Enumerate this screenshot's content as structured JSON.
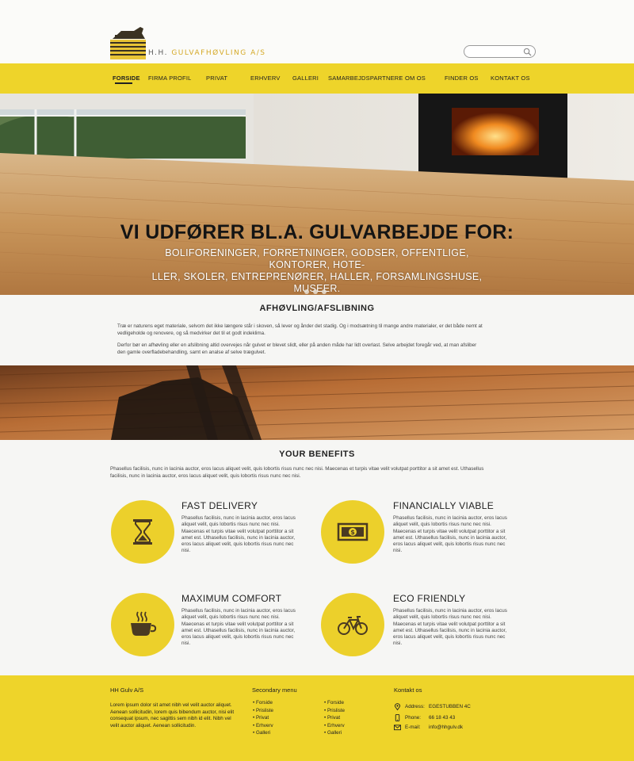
{
  "brand": {
    "name_prefix": "H.H.",
    "name_main": "GULVAFHØVLING A/S",
    "accent_color": "#eed42a"
  },
  "search": {
    "placeholder": ""
  },
  "nav": {
    "items": [
      {
        "label": "FORSIDE",
        "active": true
      },
      {
        "label": "FIRMA PROFIL"
      },
      {
        "label": "PRIVAT"
      },
      {
        "label": "ERHVERV"
      },
      {
        "label": "GALLERI"
      },
      {
        "label": "SAMARBEJDSPARTNERE"
      },
      {
        "label": "OM OS"
      },
      {
        "label": "FINDER OS"
      },
      {
        "label": "KONTAKT OS"
      }
    ]
  },
  "hero": {
    "title": "VI UDFØRER BL.A. GULVARBEJDE FOR:",
    "subtitle_line1": "BOLIFORENINGER, FORRETNINGER, GODSER, OFFENTLIGE, KONTORER, HOTE-",
    "subtitle_line2": "LLER, SKOLER, ENTREPRENØRER, HALLER, FORSAMLINGSHUSE, MUSEER.",
    "slides": 3,
    "active_slide": 1
  },
  "about": {
    "title": "AFHØVLING/AFSLIBNING",
    "para1_line1": "Træ er naturens eget materiale, selvom det ikke længere står i skoven, så lever og ånder det stadig. Og i modsætning til mange andre materialer, er det både nemt at",
    "para1_line2": "vedligeholde og renovere, og så medvirker det til et godt indeklima.",
    "para2_line1": "Derfor bør en afhøvling eller en afslibning altid overvejes når gulvet er blevet slidt, eller på anden måde har lidt overlast. Selve arbejdet foregår ved, at man afsliber",
    "para2_line2": "den gamle overfladebehandling, samt en analse af selve trægulvet."
  },
  "benefits": {
    "title": "YOUR BENEFITS",
    "intro_line1": "Phasellus facilisis, nunc in lacinia auctor, eros lacus aliquet velit, quis lobortis risus nunc nec nisi. Maecenas et turpis vitae velit volutpat porttitor a sit amet est. Uthasellus",
    "intro_line2": "facilisis, nunc in lacinia auctor, eros lacus aliquet velit, quis lobortis risus nunc nec nisi.",
    "items": [
      {
        "title": "FAST DELIVERY",
        "icon": "hourglass-icon",
        "lines": [
          "Phasellus facilisis, nunc in lacinia auctor, eros lacus",
          "aliquet velit, quis lobortis risus nunc nec nisi.",
          "Maecenas et turpis vitae velit volutpat porttitor a sit",
          "amet est. Uthasellus facilisis, nunc in lacinia auctor,",
          "eros lacus aliquet velit, quis lobortis risus nunc nec",
          "nisi."
        ]
      },
      {
        "title": "FINANCIALLY VIABLE",
        "icon": "banknote-icon",
        "lines": [
          "Phasellus facilisis, nunc in lacinia auctor, eros lacus",
          "aliquet velit, quis lobortis risus nunc nec nisi.",
          "Maecenas et turpis vitae velit volutpat porttitor a sit",
          "amet est. Uthasellus facilisis, nunc in lacinia auctor,",
          "eros lacus aliquet velit, quis lobortis risus nunc nec",
          "nisi."
        ]
      },
      {
        "title": "MAXIMUM COMFORT",
        "icon": "coffee-cup-icon",
        "lines": [
          "Phasellus facilisis, nunc in lacinia auctor, eros lacus",
          "aliquet velit, quis lobortis risus nunc nec nisi.",
          "Maecenas et turpis vitae velit volutpat porttitor a sit",
          "amet est. Uthasellus facilisis, nunc in lacinia auctor,",
          "eros lacus aliquet velit, quis lobortis risus nunc nec",
          "nisi."
        ]
      },
      {
        "title": "ECO FRIENDLY",
        "icon": "bicycle-icon",
        "lines": [
          "Phasellus facilisis, nunc in lacinia auctor, eros lacus",
          "aliquet velit, quis lobortis risus nunc nec nisi.",
          "Maecenas et turpis vitae velit volutpat porttitor a sit",
          "amet est. Uthasellus facilisis, nunc in lacinia auctor,",
          "eros lacus aliquet velit, quis lobortis risus nunc nec",
          "nisi."
        ]
      }
    ]
  },
  "footer": {
    "company_heading": "HH Gulv A/S",
    "company_lines": [
      "Lorem ipsum dolor sit amet  nibh vel velit auctor aliquet.",
      "Aenean sollicitudin, lorem quis bibendum auctor, nisi elit",
      "consequat ipsum, nec sagittis sem nibh id elit. Nibh vel",
      "velit auctor aliquet. Aenean sollicitudin."
    ],
    "menu_heading": "Secondary menu",
    "menu_col1": [
      "Forside",
      "Prisliste",
      "Privat",
      "Erhverv",
      "Galleri"
    ],
    "menu_col2": [
      "Forside",
      "Prisliste",
      "Privat",
      "Erhverv",
      "Galleri"
    ],
    "contact_heading": "Kontakt os",
    "contact": [
      {
        "icon": "location-pin-icon",
        "label": "Address:",
        "value": "EGESTUBBEN 4C"
      },
      {
        "icon": "phone-icon",
        "label": "Phone:",
        "value": "66 18 43 43"
      },
      {
        "icon": "envelope-icon",
        "label": "E-mail:",
        "value": "info@hhgulv.dk"
      }
    ]
  }
}
